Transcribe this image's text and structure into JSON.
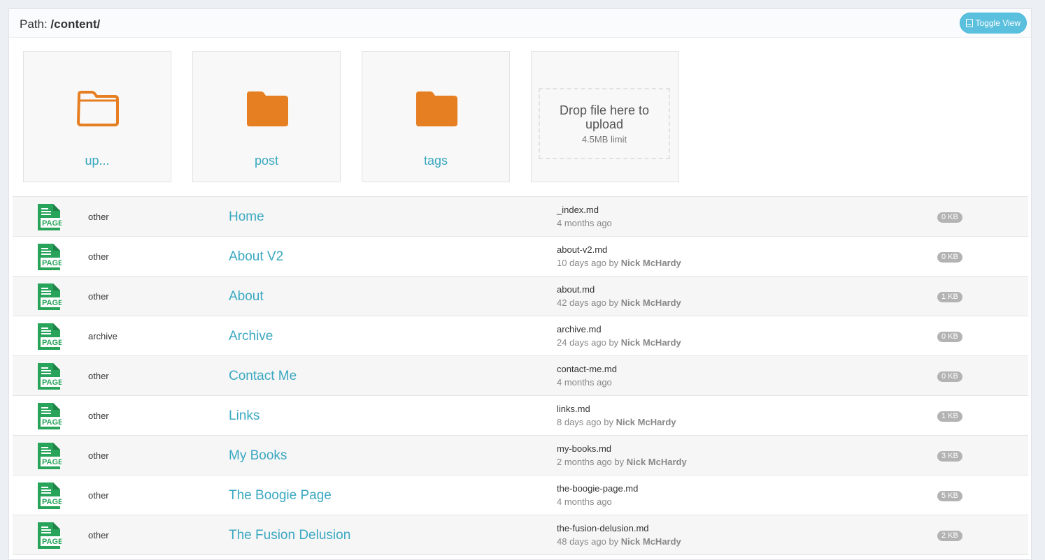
{
  "header": {
    "path_prefix": "Path: ",
    "path_value": "/content/",
    "toggle_label": "Toggle View"
  },
  "colors": {
    "accent": "#3aa8c1",
    "folder": "#e67e22",
    "page_icon": "#27a35a",
    "button": "#5bc0de"
  },
  "tiles": {
    "up": {
      "label": "up...",
      "icon": "folder-outline-icon"
    },
    "post": {
      "label": "post",
      "icon": "folder-icon"
    },
    "tags": {
      "label": "tags",
      "icon": "folder-icon"
    },
    "upload": {
      "title": "Drop file here to upload",
      "limit": "4.5MB limit"
    }
  },
  "files": [
    {
      "type": "other",
      "title": "Home",
      "filename": "_index.md",
      "meta": "4 months ago",
      "author": "",
      "size": "0 KB"
    },
    {
      "type": "other",
      "title": "About V2",
      "filename": "about-v2.md",
      "meta": "10 days ago by ",
      "author": "Nick McHardy",
      "size": "0 KB"
    },
    {
      "type": "other",
      "title": "About",
      "filename": "about.md",
      "meta": "42 days ago by ",
      "author": "Nick McHardy",
      "size": "1 KB"
    },
    {
      "type": "archive",
      "title": "Archive",
      "filename": "archive.md",
      "meta": "24 days ago by ",
      "author": "Nick McHardy",
      "size": "0 KB"
    },
    {
      "type": "other",
      "title": "Contact Me",
      "filename": "contact-me.md",
      "meta": "4 months ago",
      "author": "",
      "size": "0 KB"
    },
    {
      "type": "other",
      "title": "Links",
      "filename": "links.md",
      "meta": "8 days ago by ",
      "author": "Nick McHardy",
      "size": "1 KB"
    },
    {
      "type": "other",
      "title": "My Books",
      "filename": "my-books.md",
      "meta": "2 months ago by ",
      "author": "Nick McHardy",
      "size": "3 KB"
    },
    {
      "type": "other",
      "title": "The Boogie Page",
      "filename": "the-boogie-page.md",
      "meta": "4 months ago",
      "author": "",
      "size": "5 KB"
    },
    {
      "type": "other",
      "title": "The Fusion Delusion",
      "filename": "the-fusion-delusion.md",
      "meta": "48 days ago by ",
      "author": "Nick McHardy",
      "size": "2 KB"
    }
  ],
  "page_icon_text": "PAGE"
}
